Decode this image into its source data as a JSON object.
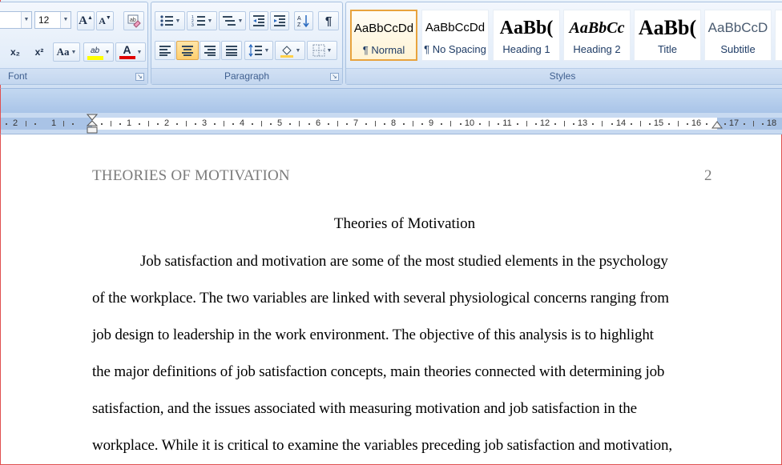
{
  "ribbon": {
    "font": {
      "size": "12",
      "grow_label": "A",
      "shrink_label": "A",
      "case_label": "Aa",
      "subscript_label": "x₂",
      "superscript_label": "x²",
      "highlight_label": "ab",
      "font_color_label": "A",
      "group_label": "Font"
    },
    "paragraph": {
      "group_label": "Paragraph",
      "show_marks_label": "¶"
    },
    "styles": {
      "group_label": "Styles",
      "items": [
        {
          "sample": "AaBbCcDd",
          "name": "¶ Normal"
        },
        {
          "sample": "AaBbCcDd",
          "name": "¶ No Spacing"
        },
        {
          "sample": "AaBb(",
          "name": "Heading 1"
        },
        {
          "sample": "AaBbCc",
          "name": "Heading 2"
        },
        {
          "sample": "AaBb(",
          "name": "Title"
        },
        {
          "sample": "AaBbCcD",
          "name": "Subtitle"
        },
        {
          "sample": "A",
          "name": "S"
        }
      ]
    }
  },
  "ruler": {
    "left_numbers": [
      "2",
      "1"
    ],
    "right_numbers": [
      "1",
      "2",
      "3",
      "4",
      "5",
      "6",
      "7",
      "8",
      "9",
      "10",
      "11",
      "12",
      "13",
      "14",
      "15",
      "16",
      "17",
      "18"
    ]
  },
  "document": {
    "running_head": "THEORIES OF MOTIVATION",
    "page_number": "2",
    "title": "Theories of Motivation",
    "lines": [
      "Job satisfaction and motivation are some of the most studied elements in the psychology",
      "of the workplace. The two variables are linked with several physiological concerns ranging from",
      "job design to leadership in the work environment. The objective of this analysis is to highlight",
      "the major definitions of job satisfaction concepts, main theories connected with determining job",
      "satisfaction, and the issues associated with measuring motivation and job satisfaction in the",
      "workplace. While it is critical to examine the variables preceding job satisfaction and motivation,"
    ]
  },
  "colors": {
    "ribbon_bg": "#dbe8f7",
    "group_label_text": "#3f5f8f",
    "selected_style_border": "#e8a33d",
    "highlight_yellow": "#ffff00",
    "font_color_red": "#e00000",
    "running_head_gray": "#7b7b7b"
  }
}
